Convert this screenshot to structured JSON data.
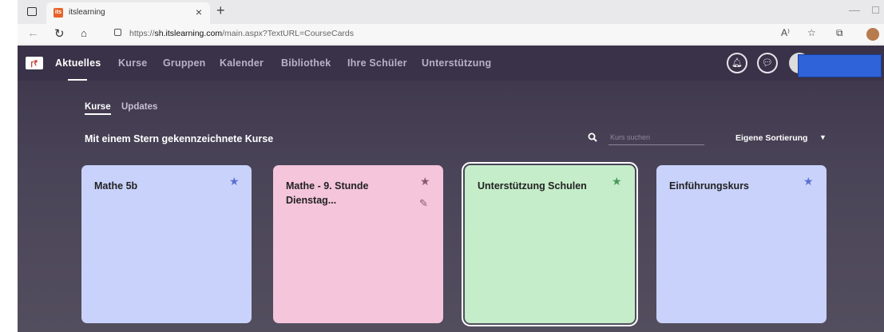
{
  "browser": {
    "tab_title": "itslearning",
    "favicon_text": "its",
    "tab_close": "×",
    "new_tab": "+",
    "url_prefix": "https://",
    "url_domain": "sh.itslearning.com",
    "url_path": "/main.aspx?TextURL=CourseCards"
  },
  "topnav": {
    "logo_text": "ꞅ₹",
    "items": [
      "Aktuelles",
      "Kurse",
      "Gruppen",
      "Kalender",
      "Bibliothek",
      "Ihre Schüler",
      "Unterstützung"
    ],
    "active": "Aktuelles"
  },
  "subtabs": [
    "Kurse",
    "Updates"
  ],
  "section": {
    "title": "Mit einem Stern gekennzeichnete Kurse",
    "search_placeholder": "Kurs suchen",
    "sort_label": "Eigene Sortierung",
    "sort_arrow": "▼"
  },
  "cards": [
    {
      "title": "Mathe 5b",
      "bg": "#c9d2fb",
      "star_color": "#5b6fd1",
      "star": "★"
    },
    {
      "title": "Mathe - 9. Stunde Dienstag...",
      "bg": "#f5c5dc",
      "star_color": "#8a5a6c",
      "star": "★",
      "edit_icon": "✎"
    },
    {
      "title": "Unterstützung Schulen",
      "bg": "#c5edca",
      "star_color": "#4a9a5a",
      "star": "★",
      "selected": true
    },
    {
      "title": "Einführungskurs",
      "bg": "#c9d2fb",
      "star_color": "#5b6fd1",
      "star": "★"
    }
  ],
  "colors": {
    "app_bg": "#4a4458",
    "nav_bg": "#3a3248",
    "redaction": "#2f63d9"
  }
}
